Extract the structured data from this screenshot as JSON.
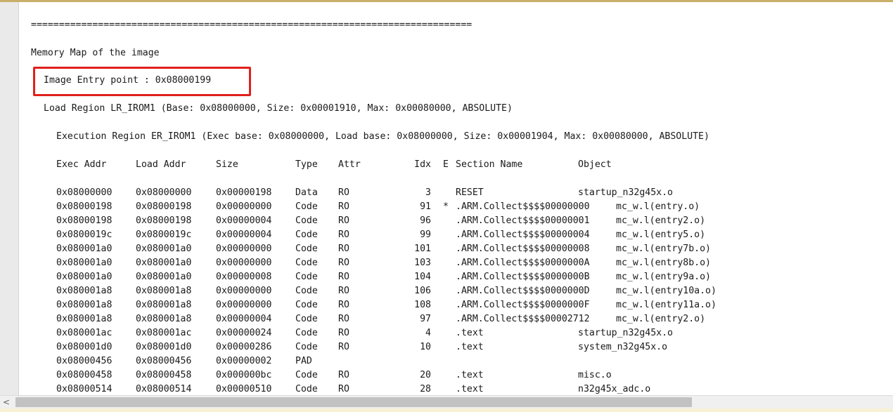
{
  "editor": {
    "separator": "===============================================================================",
    "memory_map_title": "Memory Map of the image",
    "entry_point": "Image Entry point : 0x08000199",
    "load_region": "Load Region LR_IROM1 (Base: 0x08000000, Size: 0x00001910, Max: 0x00080000, ABSOLUTE)",
    "exec_region": "Execution Region ER_IROM1 (Exec base: 0x08000000, Load base: 0x08000000, Size: 0x00001904, Max: 0x00080000, ABSOLUTE)",
    "headers": {
      "exec_addr": "Exec Addr",
      "load_addr": "Load Addr",
      "size": "Size",
      "type": "Type",
      "attr": "Attr",
      "idx": "Idx",
      "e": "E",
      "section_name": "Section Name",
      "object": "Object"
    },
    "rows": [
      {
        "exec": "0x08000000",
        "load": "0x08000000",
        "size": "0x00000198",
        "type": "Data",
        "attr": "RO",
        "idx": "3",
        "e": "",
        "section": "RESET",
        "object": "startup_n32g45x.o"
      },
      {
        "exec": "0x08000198",
        "load": "0x08000198",
        "size": "0x00000000",
        "type": "Code",
        "attr": "RO",
        "idx": "91",
        "e": "*",
        "section": ".ARM.Collect$$$$00000000",
        "object": "mc_w.l(entry.o)"
      },
      {
        "exec": "0x08000198",
        "load": "0x08000198",
        "size": "0x00000004",
        "type": "Code",
        "attr": "RO",
        "idx": "96",
        "e": "",
        "section": ".ARM.Collect$$$$00000001",
        "object": "mc_w.l(entry2.o)"
      },
      {
        "exec": "0x0800019c",
        "load": "0x0800019c",
        "size": "0x00000004",
        "type": "Code",
        "attr": "RO",
        "idx": "99",
        "e": "",
        "section": ".ARM.Collect$$$$00000004",
        "object": "mc_w.l(entry5.o)"
      },
      {
        "exec": "0x080001a0",
        "load": "0x080001a0",
        "size": "0x00000000",
        "type": "Code",
        "attr": "RO",
        "idx": "101",
        "e": "",
        "section": ".ARM.Collect$$$$00000008",
        "object": "mc_w.l(entry7b.o)"
      },
      {
        "exec": "0x080001a0",
        "load": "0x080001a0",
        "size": "0x00000000",
        "type": "Code",
        "attr": "RO",
        "idx": "103",
        "e": "",
        "section": ".ARM.Collect$$$$0000000A",
        "object": "mc_w.l(entry8b.o)"
      },
      {
        "exec": "0x080001a0",
        "load": "0x080001a0",
        "size": "0x00000008",
        "type": "Code",
        "attr": "RO",
        "idx": "104",
        "e": "",
        "section": ".ARM.Collect$$$$0000000B",
        "object": "mc_w.l(entry9a.o)"
      },
      {
        "exec": "0x080001a8",
        "load": "0x080001a8",
        "size": "0x00000000",
        "type": "Code",
        "attr": "RO",
        "idx": "106",
        "e": "",
        "section": ".ARM.Collect$$$$0000000D",
        "object": "mc_w.l(entry10a.o)"
      },
      {
        "exec": "0x080001a8",
        "load": "0x080001a8",
        "size": "0x00000000",
        "type": "Code",
        "attr": "RO",
        "idx": "108",
        "e": "",
        "section": ".ARM.Collect$$$$0000000F",
        "object": "mc_w.l(entry11a.o)"
      },
      {
        "exec": "0x080001a8",
        "load": "0x080001a8",
        "size": "0x00000004",
        "type": "Code",
        "attr": "RO",
        "idx": "97",
        "e": "",
        "section": ".ARM.Collect$$$$00002712",
        "object": "mc_w.l(entry2.o)"
      },
      {
        "exec": "0x080001ac",
        "load": "0x080001ac",
        "size": "0x00000024",
        "type": "Code",
        "attr": "RO",
        "idx": "4",
        "e": "",
        "section": ".text",
        "object": "startup_n32g45x.o"
      },
      {
        "exec": "0x080001d0",
        "load": "0x080001d0",
        "size": "0x00000286",
        "type": "Code",
        "attr": "RO",
        "idx": "10",
        "e": "",
        "section": ".text",
        "object": "system_n32g45x.o"
      },
      {
        "exec": "0x08000456",
        "load": "0x08000456",
        "size": "0x00000002",
        "type": "PAD",
        "attr": "",
        "idx": "",
        "e": "",
        "section": "",
        "object": ""
      },
      {
        "exec": "0x08000458",
        "load": "0x08000458",
        "size": "0x000000bc",
        "type": "Code",
        "attr": "RO",
        "idx": "20",
        "e": "",
        "section": ".text",
        "object": "misc.o"
      },
      {
        "exec": "0x08000514",
        "load": "0x08000514",
        "size": "0x00000510",
        "type": "Code",
        "attr": "RO",
        "idx": "28",
        "e": "",
        "section": ".text",
        "object": "n32g45x_adc.o"
      }
    ]
  },
  "scrollbar": {
    "left_arrow_icon": "chevron-left-icon",
    "left_arrow_glyph": "<",
    "thumb_fraction": 0.76
  },
  "colors": {
    "highlight_box": "#e0201b",
    "gutter": "#eaeaea",
    "scroll_thumb": "#c2c2c2"
  }
}
